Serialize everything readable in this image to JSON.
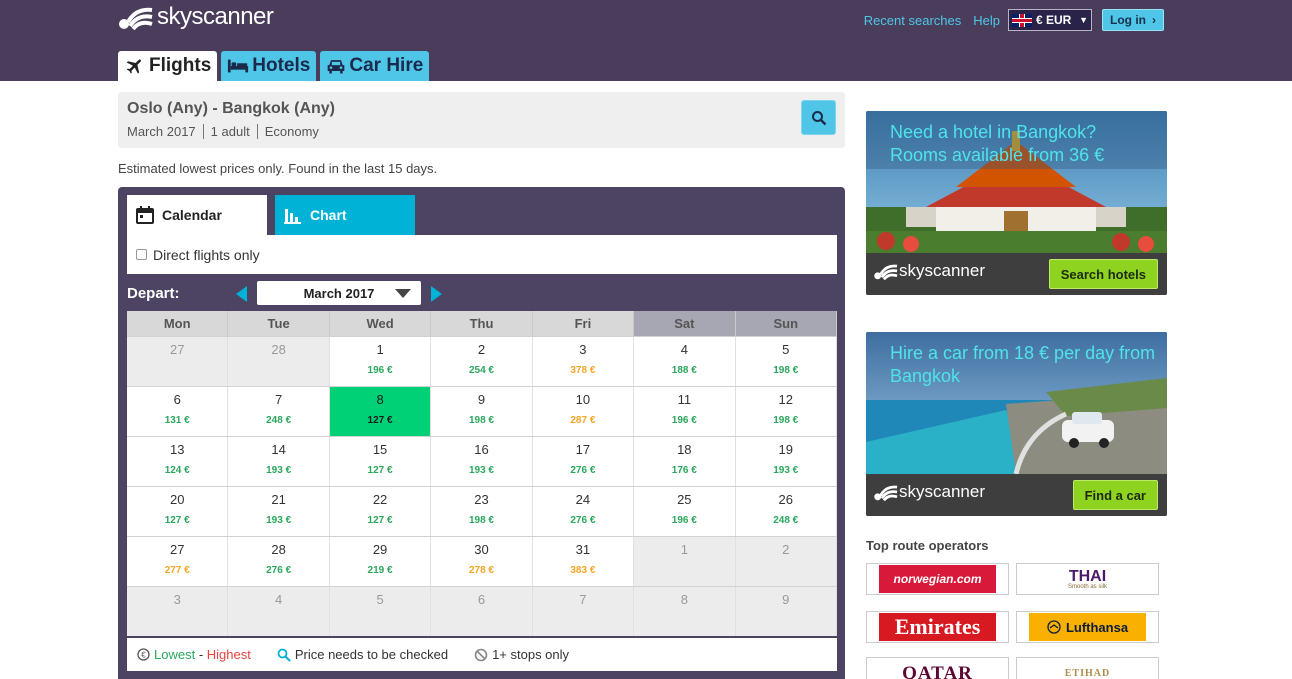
{
  "brand": {
    "name": "skyscanner"
  },
  "header": {
    "links": [
      "Recent searches",
      "Help"
    ],
    "currency": "€ EUR",
    "login": "Log in"
  },
  "nav": {
    "tabs": [
      {
        "label": "Flights",
        "icon": "plane-icon",
        "active": true
      },
      {
        "label": "Hotels",
        "icon": "bed-icon",
        "active": false
      },
      {
        "label": "Car Hire",
        "icon": "car-icon",
        "active": false
      }
    ]
  },
  "search": {
    "route": "Oslo (Any) - Bangkok (Any)",
    "date": "March 2017",
    "passengers": "1 adult",
    "cabin": "Economy"
  },
  "estimate_note": "Estimated lowest prices only. Found in the last 15 days.",
  "views": {
    "calendar": "Calendar",
    "chart": "Chart"
  },
  "direct_only": "Direct flights only",
  "calendar": {
    "depart_label": "Depart:",
    "month": "March 2017",
    "weekdays": [
      "Mon",
      "Tue",
      "Wed",
      "Thu",
      "Fri",
      "Sat",
      "Sun"
    ],
    "weeks": [
      [
        {
          "day": "27",
          "out": true
        },
        {
          "day": "28",
          "out": true
        },
        {
          "day": "1",
          "price": "196 €",
          "tier": "green"
        },
        {
          "day": "2",
          "price": "254 €",
          "tier": "green"
        },
        {
          "day": "3",
          "price": "378 €",
          "tier": "amber"
        },
        {
          "day": "4",
          "price": "188 €",
          "tier": "green"
        },
        {
          "day": "5",
          "price": "198 €",
          "tier": "green"
        }
      ],
      [
        {
          "day": "6",
          "price": "131 €",
          "tier": "green"
        },
        {
          "day": "7",
          "price": "248 €",
          "tier": "green"
        },
        {
          "day": "8",
          "price": "127 €",
          "tier": "green",
          "selected": true
        },
        {
          "day": "9",
          "price": "198 €",
          "tier": "green"
        },
        {
          "day": "10",
          "price": "287 €",
          "tier": "amber"
        },
        {
          "day": "11",
          "price": "196 €",
          "tier": "green"
        },
        {
          "day": "12",
          "price": "198 €",
          "tier": "green"
        }
      ],
      [
        {
          "day": "13",
          "price": "124 €",
          "tier": "green"
        },
        {
          "day": "14",
          "price": "193 €",
          "tier": "green"
        },
        {
          "day": "15",
          "price": "127 €",
          "tier": "green"
        },
        {
          "day": "16",
          "price": "193 €",
          "tier": "green"
        },
        {
          "day": "17",
          "price": "276 €",
          "tier": "green"
        },
        {
          "day": "18",
          "price": "176 €",
          "tier": "green"
        },
        {
          "day": "19",
          "price": "193 €",
          "tier": "green"
        }
      ],
      [
        {
          "day": "20",
          "price": "127 €",
          "tier": "green"
        },
        {
          "day": "21",
          "price": "193 €",
          "tier": "green"
        },
        {
          "day": "22",
          "price": "127 €",
          "tier": "green"
        },
        {
          "day": "23",
          "price": "198 €",
          "tier": "green"
        },
        {
          "day": "24",
          "price": "276 €",
          "tier": "green"
        },
        {
          "day": "25",
          "price": "196 €",
          "tier": "green"
        },
        {
          "day": "26",
          "price": "248 €",
          "tier": "green"
        }
      ],
      [
        {
          "day": "27",
          "price": "277 €",
          "tier": "amber"
        },
        {
          "day": "28",
          "price": "276 €",
          "tier": "green"
        },
        {
          "day": "29",
          "price": "219 €",
          "tier": "green"
        },
        {
          "day": "30",
          "price": "278 €",
          "tier": "amber"
        },
        {
          "day": "31",
          "price": "383 €",
          "tier": "amber"
        },
        {
          "day": "1",
          "out": true
        },
        {
          "day": "2",
          "out": true
        }
      ],
      [
        {
          "day": "3",
          "out": true
        },
        {
          "day": "4",
          "out": true
        },
        {
          "day": "5",
          "out": true
        },
        {
          "day": "6",
          "out": true
        },
        {
          "day": "7",
          "out": true
        },
        {
          "day": "8",
          "out": true
        },
        {
          "day": "9",
          "out": true
        }
      ]
    ]
  },
  "legend": {
    "lowest": "Lowest",
    "separator": " - ",
    "highest": "Highest",
    "check": "Price needs to be checked",
    "stops": "1+ stops only"
  },
  "ads": {
    "hotel": {
      "title": "Need a hotel in Bangkok? Rooms available from 36 €",
      "button": "Search hotels",
      "logo": "skyscanner"
    },
    "car": {
      "title": "Hire a car from 18 € per day from Bangkok",
      "button": "Find a car",
      "logo": "skyscanner"
    }
  },
  "operators": {
    "title": "Top route operators",
    "items": [
      {
        "name": "norwegian.com",
        "color": "#d81939",
        "text_color": "#ffffff"
      },
      {
        "name": "THAI",
        "sub": "Smooth as silk",
        "color": "#ffffff",
        "text_color": "#4a1a6b"
      },
      {
        "name": "Emirates",
        "color": "#d71921",
        "text_color": "#ffffff"
      },
      {
        "name": "Lufthansa",
        "color": "#f9b000",
        "text_color": "#0a1d3d"
      },
      {
        "name": "QATAR",
        "color": "#ffffff",
        "text_color": "#5c0632"
      },
      {
        "name": "ETIHAD",
        "color": "#ffffff",
        "text_color": "#b08c4a"
      }
    ]
  },
  "colors": {
    "header_bg": "#493d5b",
    "accent": "#4fc6e8",
    "price_green": "#2aa75c",
    "price_amber": "#f5a623",
    "selected_day": "#00d176",
    "ad_button": "#8fd321"
  }
}
